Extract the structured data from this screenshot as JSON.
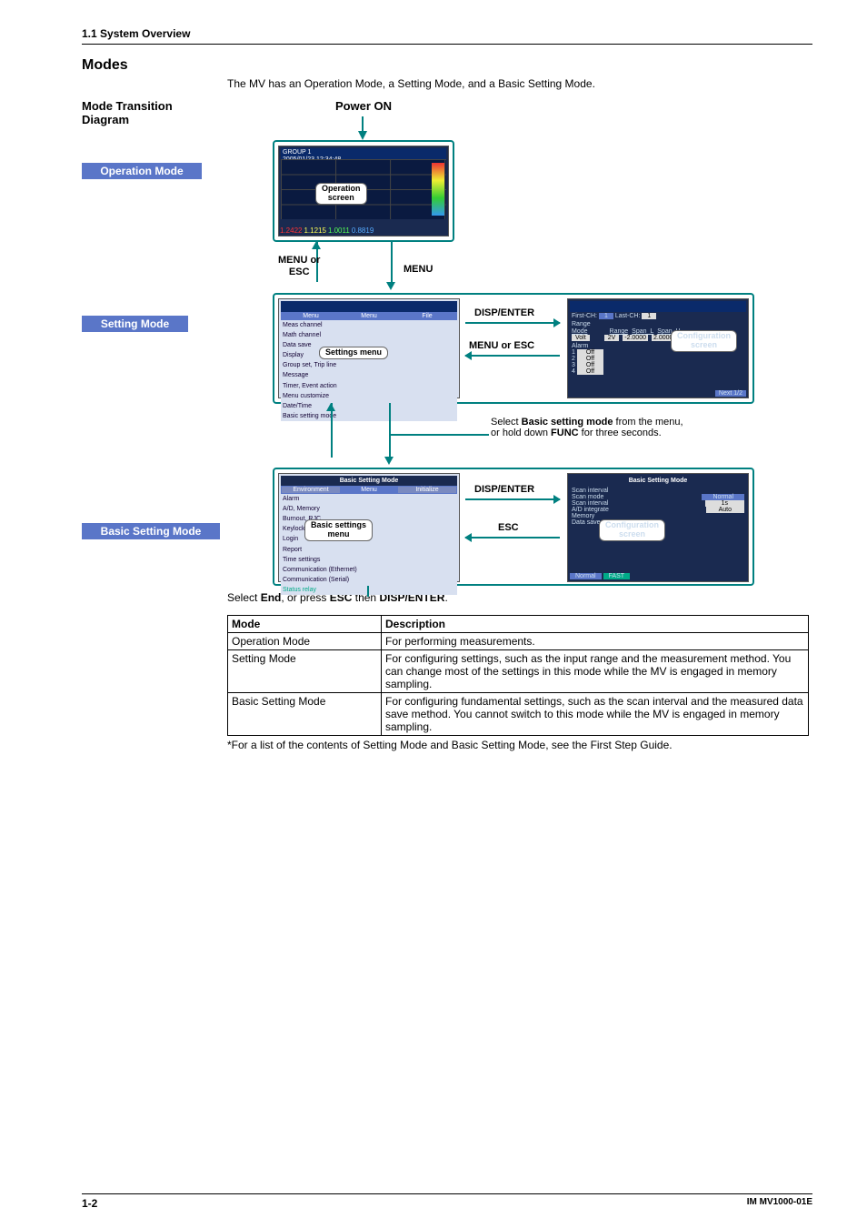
{
  "header": {
    "section": "1.1  System Overview"
  },
  "title": "Modes",
  "intro": "The MV has an Operation Mode, a Setting Mode, and a Basic Setting Mode.",
  "diagram": {
    "subtitle": "Mode Transition Diagram",
    "power_on": "Power ON",
    "operation_label": "Operation Mode",
    "setting_label": "Setting Mode",
    "basic_label": "Basic Setting Mode",
    "screen_tag_operation": "Operation\nscreen",
    "screen_tag_settings_menu": "Settings menu",
    "screen_tag_config": "Configuration\nscreen",
    "screen_tag_basic_menu": "Basic settings\nmenu",
    "screen_tag_basic_config": "Configuration\nscreen",
    "key_menu_esc": "MENU or\nESC",
    "key_menu": "MENU",
    "key_disp_enter": "DISP/ENTER",
    "key_menu_or_esc": "MENU or ESC",
    "key_esc": "ESC",
    "note_select_basic_html": "Select <b>Basic setting mode</b> from the menu,\nor hold down <b>FUNC</b> for three seconds."
  },
  "footcap_html": "Select <b>End</b>, or press <b>ESC</b> then <b>DISP/ENTER</b>.",
  "table": {
    "headers": [
      "Mode",
      "Description"
    ],
    "rows": [
      {
        "mode": "Operation Mode",
        "desc": "For performing measurements."
      },
      {
        "mode": "Setting Mode",
        "desc": "For configuring settings, such as the input range and the measurement method. You can change most of the settings in this mode while the MV is engaged in memory sampling."
      },
      {
        "mode": "Basic Setting Mode",
        "desc": "For configuring fundamental settings, such as the scan interval and the measured data save method. You cannot switch to this mode while the MV is engaged in memory sampling."
      }
    ]
  },
  "footnote": "*For a list of the contents of Setting Mode and Basic Setting Mode, see the First Step Guide.",
  "footer": {
    "page": "1-2",
    "docid": "IM MV1000-01E"
  },
  "screens": {
    "op_top": "GROUP 1\n2005/01/23 12:34:48",
    "op_vals": [
      "1.2422",
      "1.1215",
      "1.0011",
      "0.8819"
    ],
    "set_menu_tabs": [
      "Menu",
      "Menu",
      "File"
    ],
    "set_menu_items": [
      "Meas channel",
      "Math channel",
      "Data save",
      "Display",
      "Group set, Trip line",
      "Message",
      "Timer, Event action",
      "Menu customize",
      "Date/Time",
      "Basic setting mode"
    ],
    "set_cfg_labels": [
      "First-CH:",
      "Last-CH:",
      "Range",
      "Mode",
      "Volt",
      "Alarm",
      "1",
      "2",
      "3",
      "4",
      "Off",
      "Off",
      "Off",
      "Off",
      "Range",
      "Span_L",
      "Span_U",
      "2V",
      "-2.0000",
      "2.0000",
      "Next 1/2"
    ],
    "basic_title": "Basic Setting Mode",
    "basic_tabs": [
      "Environment",
      "Menu",
      "Initialize"
    ],
    "basic_items": [
      "Alarm",
      "A/D, Memory",
      "Burnout, RJC",
      "Keylock",
      "Login",
      "Report",
      "Time settings",
      "Communication (Ethernet)",
      "Communication (Serial)",
      "Status relay"
    ],
    "basic_cfg_items": [
      "Scan interval",
      "Scan mode",
      "Scan interval",
      "A/D integrate",
      "Memory",
      "Data save"
    ],
    "basic_cfg_vals": [
      "Normal",
      "1s",
      "Auto"
    ],
    "basic_bottom": [
      "Normal",
      "FAST"
    ]
  }
}
